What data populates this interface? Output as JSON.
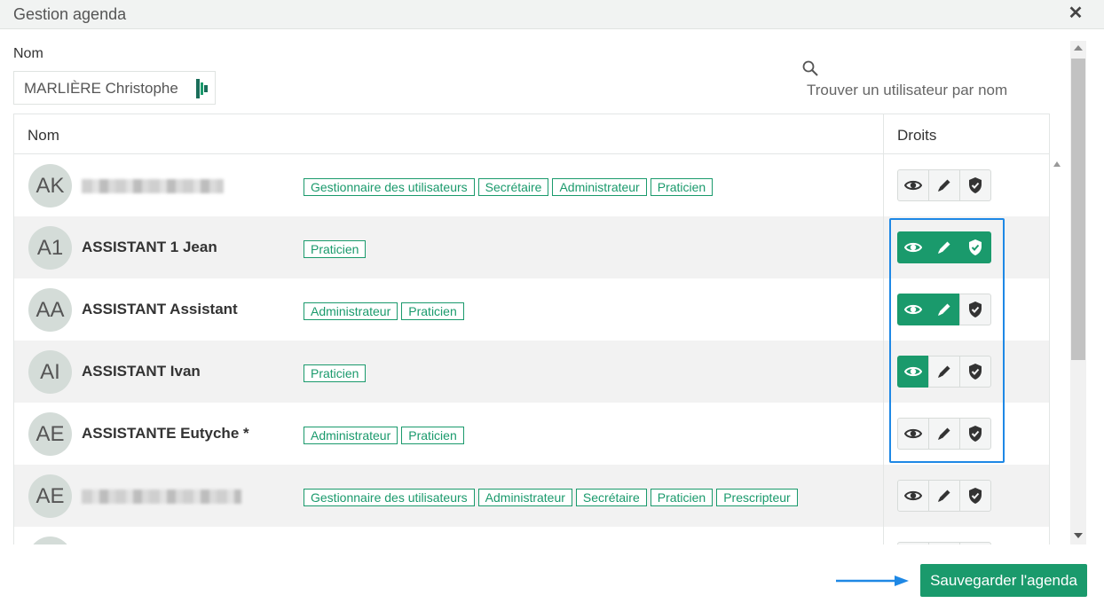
{
  "dialog": {
    "title": "Gestion agenda",
    "close_label": "✕"
  },
  "filter": {
    "nom_label": "Nom",
    "nom_value": "MARLIÈRE Christophe",
    "search_placeholder": "Trouver un utilisateur par nom"
  },
  "table": {
    "col_nom": "Nom",
    "col_droits": "Droits",
    "rows": [
      {
        "initials": "AK",
        "name": "",
        "blurred": true,
        "roles": [
          "Gestionnaire des utilisateurs",
          "Secrétaire",
          "Administrateur",
          "Praticien"
        ],
        "rights": {
          "view": false,
          "edit": false,
          "admin": false
        }
      },
      {
        "initials": "A1",
        "name": "ASSISTANT 1 Jean",
        "blurred": false,
        "roles": [
          "Praticien"
        ],
        "rights": {
          "view": true,
          "edit": true,
          "admin": true
        }
      },
      {
        "initials": "AA",
        "name": "ASSISTANT Assistant",
        "blurred": false,
        "roles": [
          "Administrateur",
          "Praticien"
        ],
        "rights": {
          "view": true,
          "edit": true,
          "admin": false
        }
      },
      {
        "initials": "AI",
        "name": "ASSISTANT Ivan",
        "blurred": false,
        "roles": [
          "Praticien"
        ],
        "rights": {
          "view": true,
          "edit": false,
          "admin": false
        }
      },
      {
        "initials": "AE",
        "name": "ASSISTANTE Eutyche *",
        "blurred": false,
        "roles": [
          "Administrateur",
          "Praticien"
        ],
        "rights": {
          "view": false,
          "edit": false,
          "admin": false
        }
      },
      {
        "initials": "AE",
        "name": "",
        "blurred": true,
        "roles": [
          "Gestionnaire des utilisateurs",
          "Administrateur",
          "Secrétaire",
          "Praticien",
          "Prescripteur"
        ],
        "rights": {
          "view": false,
          "edit": false,
          "admin": false
        }
      },
      {
        "initials": "",
        "name": "",
        "blurred": false,
        "roles": [],
        "rights": {
          "view": false,
          "edit": false,
          "admin": false
        }
      }
    ]
  },
  "footer": {
    "save_label": "Sauvegarder l'agenda"
  },
  "colors": {
    "accent": "#1a9a6c",
    "highlight": "#1e88e5"
  },
  "icons": {
    "view": "eye-icon",
    "edit": "pencil-icon",
    "admin": "shield-check-icon",
    "search": "search-icon",
    "close": "close-icon"
  }
}
